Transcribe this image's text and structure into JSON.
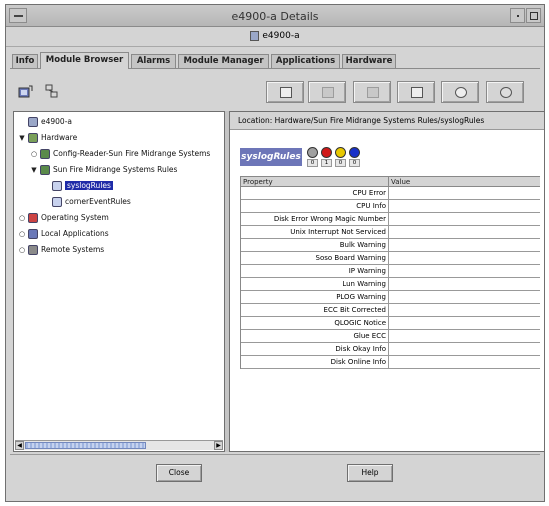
{
  "window": {
    "title": "e4900-a Details",
    "subtitle": "e4900-a"
  },
  "tabs": [
    {
      "label": "Info",
      "active": false
    },
    {
      "label": "Module Browser",
      "active": true
    },
    {
      "label": "Alarms",
      "active": false
    },
    {
      "label": "Module Manager",
      "active": false
    },
    {
      "label": "Applications",
      "active": false
    },
    {
      "label": "Hardware",
      "active": false
    }
  ],
  "toolbar": {
    "left_icons": [
      "hierarchy-view-icon",
      "topology-view-icon"
    ],
    "buttons": [
      {
        "icon": "edit-icon",
        "enabled": true
      },
      {
        "icon": "graph-icon",
        "enabled": false
      },
      {
        "icon": "probe-icon",
        "enabled": false
      },
      {
        "icon": "attribute-editor-icon",
        "enabled": true
      },
      {
        "icon": "refresh-icon",
        "enabled": true
      },
      {
        "icon": "settings-icon",
        "enabled": true
      }
    ]
  },
  "tree": {
    "items": [
      {
        "label": "e4900-a",
        "indent": 0,
        "expander": "",
        "icon": "host"
      },
      {
        "label": "Hardware",
        "indent": 0,
        "expander": "▼",
        "icon": "hardware"
      },
      {
        "label": "Config-Reader-Sun Fire Midrange Systems",
        "indent": 1,
        "expander": "○",
        "icon": "module"
      },
      {
        "label": "Sun Fire Midrange Systems Rules",
        "indent": 1,
        "expander": "▼",
        "icon": "module"
      },
      {
        "label": "syslogRules",
        "indent": 2,
        "expander": "",
        "icon": "table",
        "selected": true
      },
      {
        "label": "cornerEventRules",
        "indent": 2,
        "expander": "",
        "icon": "table"
      },
      {
        "label": "Operating System",
        "indent": 0,
        "expander": "○",
        "icon": "os"
      },
      {
        "label": "Local Applications",
        "indent": 0,
        "expander": "○",
        "icon": "apps"
      },
      {
        "label": "Remote Systems",
        "indent": 0,
        "expander": "○",
        "icon": "remote"
      }
    ]
  },
  "location": {
    "label": "Location:",
    "path": "Hardware/Sun Fire Midrange Systems Rules/syslogRules"
  },
  "badge": {
    "label": "syslogRules"
  },
  "status_counts": [
    {
      "icon": "down-alarm-icon",
      "count": "0",
      "color": "#a0a0a0"
    },
    {
      "icon": "critical-alarm-icon",
      "count": "1",
      "color": "#d01818"
    },
    {
      "icon": "major-alarm-icon",
      "count": "0",
      "color": "#e8c800"
    },
    {
      "icon": "minor-alarm-icon",
      "count": "0",
      "color": "#1830c8"
    }
  ],
  "table": {
    "headers": {
      "property": "Property",
      "value": "Value"
    },
    "rows": [
      {
        "property": "CPU Error",
        "value": ""
      },
      {
        "property": "CPU Info",
        "value": ""
      },
      {
        "property": "Disk Error Wrong Magic Number",
        "value": ""
      },
      {
        "property": "Unix Interrupt Not Serviced",
        "value": ""
      },
      {
        "property": "Bulk Warning",
        "value": ""
      },
      {
        "property": "Soso Board Warning",
        "value": ""
      },
      {
        "property": "IP Warning",
        "value": ""
      },
      {
        "property": "Lun Warning",
        "value": ""
      },
      {
        "property": "PLOG Warning",
        "value": ""
      },
      {
        "property": "ECC Bit Corrected",
        "value": ""
      },
      {
        "property": "QLOGIC Notice",
        "value": ""
      },
      {
        "property": "Glue ECC",
        "value": ""
      },
      {
        "property": "Disk Okay Info",
        "value": ""
      },
      {
        "property": "Disk Online Info",
        "value": ""
      }
    ]
  },
  "buttons": {
    "close": "Close",
    "help": "Help"
  }
}
